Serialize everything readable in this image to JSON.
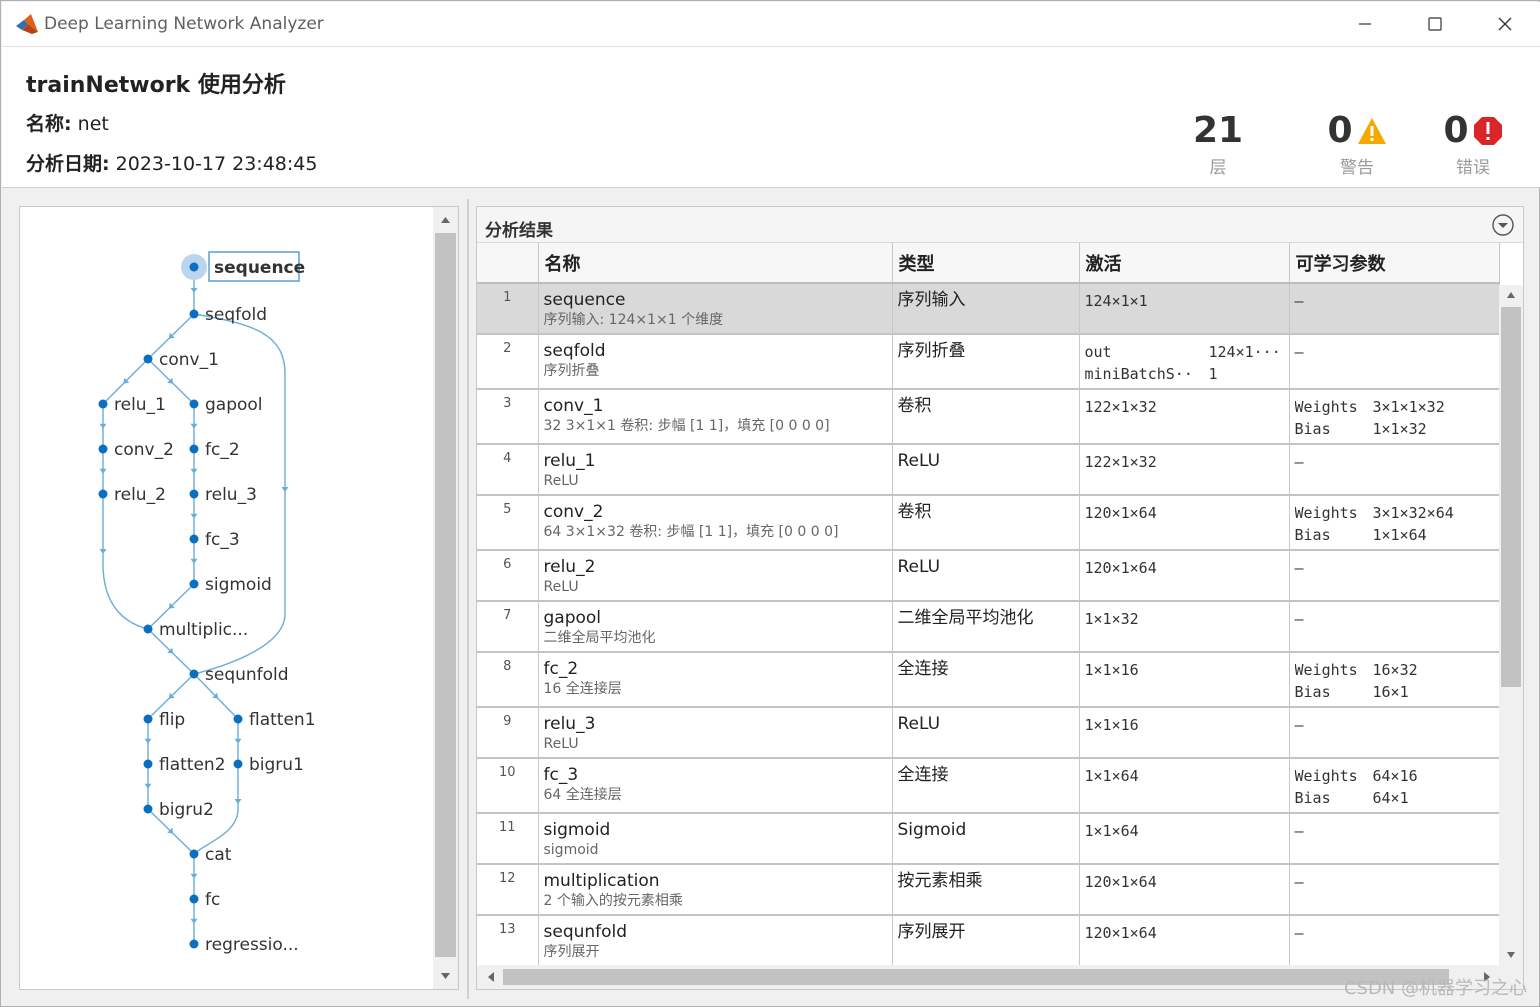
{
  "window": {
    "title": "Deep Learning Network Analyzer"
  },
  "header": {
    "title": "trainNetwork 使用分析",
    "name_label": "名称:",
    "name_value": "net",
    "date_label": "分析日期:",
    "date_value": "2023-10-17 23:48:45",
    "layers_count": "21",
    "layers_label": "层",
    "warnings_count": "0",
    "warnings_label": "警告",
    "errors_count": "0",
    "errors_label": "错误"
  },
  "graph": {
    "nodes": [
      {
        "id": "sequence",
        "label": "sequence"
      },
      {
        "id": "seqfold",
        "label": "seqfold"
      },
      {
        "id": "conv_1",
        "label": "conv_1"
      },
      {
        "id": "relu_1",
        "label": "relu_1"
      },
      {
        "id": "gapool",
        "label": "gapool"
      },
      {
        "id": "conv_2",
        "label": "conv_2"
      },
      {
        "id": "fc_2",
        "label": "fc_2"
      },
      {
        "id": "relu_2",
        "label": "relu_2"
      },
      {
        "id": "relu_3",
        "label": "relu_3"
      },
      {
        "id": "fc_3",
        "label": "fc_3"
      },
      {
        "id": "sigmoid",
        "label": "sigmoid"
      },
      {
        "id": "multiplic",
        "label": "multiplic..."
      },
      {
        "id": "sequnfold",
        "label": "sequnfold"
      },
      {
        "id": "flip",
        "label": "flip"
      },
      {
        "id": "flatten1",
        "label": "flatten1"
      },
      {
        "id": "flatten2",
        "label": "flatten2"
      },
      {
        "id": "bigru1",
        "label": "bigru1"
      },
      {
        "id": "bigru2",
        "label": "bigru2"
      },
      {
        "id": "cat",
        "label": "cat"
      },
      {
        "id": "fc",
        "label": "fc"
      },
      {
        "id": "regressio",
        "label": "regressio..."
      }
    ]
  },
  "results": {
    "title": "分析结果",
    "columns": [
      "",
      "名称",
      "类型",
      "激活",
      "可学习参数"
    ],
    "rows": [
      {
        "idx": "1",
        "name": "sequence",
        "desc": "序列输入: 124×1×1 个维度",
        "type": "序列输入",
        "act": [
          [
            "124×1×1",
            ""
          ]
        ],
        "params": [
          [
            "–",
            ""
          ]
        ]
      },
      {
        "idx": "2",
        "name": "seqfold",
        "desc": "序列折叠",
        "type": "序列折叠",
        "act": [
          [
            "out",
            "124×1···"
          ],
          [
            "miniBatchS···",
            "1"
          ]
        ],
        "params": [
          [
            "–",
            ""
          ]
        ]
      },
      {
        "idx": "3",
        "name": "conv_1",
        "desc": "32 3×1×1 卷积: 步幅 [1 1]，填充 [0 0 0 0]",
        "type": "卷积",
        "act": [
          [
            "122×1×32",
            ""
          ]
        ],
        "params": [
          [
            "Weights",
            "3×1×1×32"
          ],
          [
            "Bias",
            "1×1×32"
          ]
        ]
      },
      {
        "idx": "4",
        "name": "relu_1",
        "desc": "ReLU",
        "type": "ReLU",
        "act": [
          [
            "122×1×32",
            ""
          ]
        ],
        "params": [
          [
            "–",
            ""
          ]
        ]
      },
      {
        "idx": "5",
        "name": "conv_2",
        "desc": "64 3×1×32 卷积: 步幅 [1 1]，填充 [0 0 0 0]",
        "type": "卷积",
        "act": [
          [
            "120×1×64",
            ""
          ]
        ],
        "params": [
          [
            "Weights",
            "3×1×32×64"
          ],
          [
            "Bias",
            "1×1×64"
          ]
        ]
      },
      {
        "idx": "6",
        "name": "relu_2",
        "desc": "ReLU",
        "type": "ReLU",
        "act": [
          [
            "120×1×64",
            ""
          ]
        ],
        "params": [
          [
            "–",
            ""
          ]
        ]
      },
      {
        "idx": "7",
        "name": "gapool",
        "desc": "二维全局平均池化",
        "type": "二维全局平均池化",
        "act": [
          [
            "1×1×32",
            ""
          ]
        ],
        "params": [
          [
            "–",
            ""
          ]
        ]
      },
      {
        "idx": "8",
        "name": "fc_2",
        "desc": "16 全连接层",
        "type": "全连接",
        "act": [
          [
            "1×1×16",
            ""
          ]
        ],
        "params": [
          [
            "Weights",
            "16×32"
          ],
          [
            "Bias",
            "16×1"
          ]
        ]
      },
      {
        "idx": "9",
        "name": "relu_3",
        "desc": "ReLU",
        "type": "ReLU",
        "act": [
          [
            "1×1×16",
            ""
          ]
        ],
        "params": [
          [
            "–",
            ""
          ]
        ]
      },
      {
        "idx": "10",
        "name": "fc_3",
        "desc": "64 全连接层",
        "type": "全连接",
        "act": [
          [
            "1×1×64",
            ""
          ]
        ],
        "params": [
          [
            "Weights",
            "64×16"
          ],
          [
            "Bias",
            "64×1"
          ]
        ]
      },
      {
        "idx": "11",
        "name": "sigmoid",
        "desc": "sigmoid",
        "type": "Sigmoid",
        "act": [
          [
            "1×1×64",
            ""
          ]
        ],
        "params": [
          [
            "–",
            ""
          ]
        ]
      },
      {
        "idx": "12",
        "name": "multiplication",
        "desc": "2 个输入的按元素相乘",
        "type": "按元素相乘",
        "act": [
          [
            "120×1×64",
            ""
          ]
        ],
        "params": [
          [
            "–",
            ""
          ]
        ]
      },
      {
        "idx": "13",
        "name": "sequnfold",
        "desc": "序列展开",
        "type": "序列展开",
        "act": [
          [
            "120×1×64",
            ""
          ]
        ],
        "params": [
          [
            "–",
            ""
          ]
        ]
      }
    ]
  },
  "watermark": "CSDN @机器学习之心",
  "colors": {
    "node": "#0b6fc0",
    "edge": "#6aaed8",
    "selected_row": "#d9d9d9",
    "warning": "#f5a800",
    "error": "#d9262b"
  }
}
